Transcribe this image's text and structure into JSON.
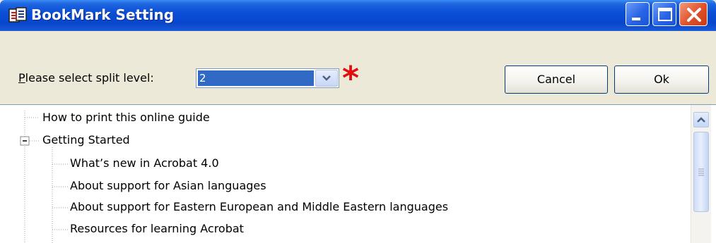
{
  "window": {
    "title": "BookMark Setting",
    "controls": {
      "minimize": "minimize",
      "maximize": "maximize",
      "close": "close"
    }
  },
  "split": {
    "label_first": "P",
    "label_rest": "lease select split level:",
    "selected_value": "2",
    "required_marker": "*"
  },
  "buttons": {
    "cancel": "Cancel",
    "ok": "Ok"
  },
  "tree": {
    "items": [
      {
        "label": "How to print this online guide",
        "level": 0
      },
      {
        "label": "Getting Started",
        "level": 0,
        "expanded": true
      },
      {
        "label": "What’s new in Acrobat 4.0",
        "level": 1
      },
      {
        "label": "About support for Asian languages",
        "level": 1
      },
      {
        "label": "About support for Eastern European and Middle Eastern languages",
        "level": 1
      },
      {
        "label": "Resources for learning Acrobat",
        "level": 1
      }
    ]
  },
  "colors": {
    "titlebar": "#0a4fd6",
    "selection": "#316ac5",
    "required": "#e01010",
    "window_bg": "#ece9d8"
  }
}
